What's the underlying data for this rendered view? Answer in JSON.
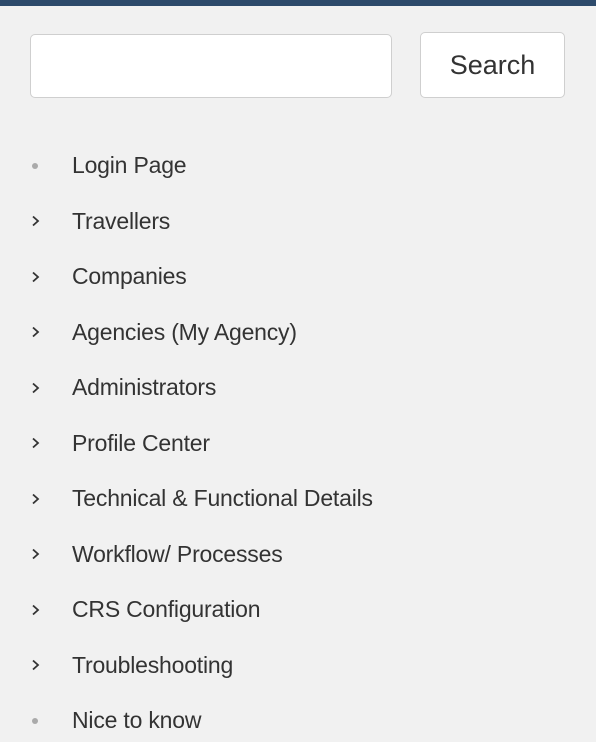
{
  "search": {
    "input_value": "",
    "button_label": "Search"
  },
  "nav": {
    "items": [
      {
        "label": "Login Page",
        "marker": "bullet-icon"
      },
      {
        "label": "Travellers",
        "marker": "chevron-right-icon"
      },
      {
        "label": "Companies",
        "marker": "chevron-right-icon"
      },
      {
        "label": "Agencies (My Agency)",
        "marker": "chevron-right-icon"
      },
      {
        "label": "Administrators",
        "marker": "chevron-right-icon"
      },
      {
        "label": "Profile Center",
        "marker": "chevron-right-icon"
      },
      {
        "label": "Technical & Functional Details",
        "marker": "chevron-right-icon"
      },
      {
        "label": "Workflow/ Processes",
        "marker": "chevron-right-icon"
      },
      {
        "label": "CRS Configuration",
        "marker": "chevron-right-icon"
      },
      {
        "label": "Troubleshooting",
        "marker": "chevron-right-icon"
      },
      {
        "label": "Nice to know",
        "marker": "bullet-icon"
      }
    ]
  },
  "colors": {
    "top_border": "#2d4a6b",
    "panel_background": "#f1f1f1",
    "text": "#333333",
    "bullet": "#aaaaaa"
  }
}
